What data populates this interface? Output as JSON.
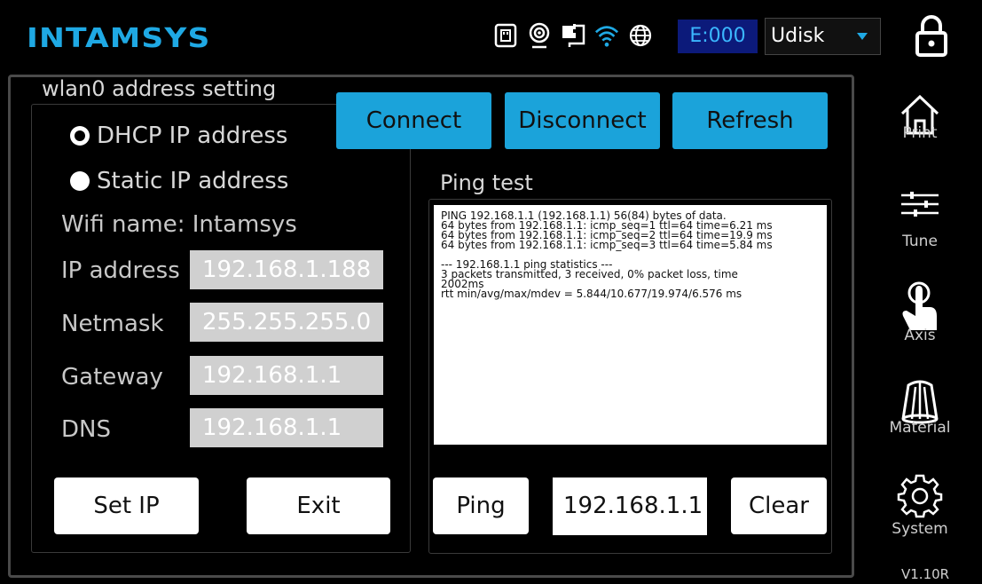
{
  "header": {
    "logo": "INTAMSYS",
    "status_icons": [
      "usb-drive-icon",
      "camera-icon",
      "power-plug-icon",
      "wifi-icon",
      "globe-icon"
    ],
    "error_code": "E:000",
    "storage_select": {
      "value": "Udisk"
    },
    "lock_icon": "lock-icon"
  },
  "panel": {
    "title": "wlan0 address setting",
    "top_buttons": {
      "connect": "Connect",
      "disconnect": "Disconnect",
      "refresh": "Refresh"
    },
    "mode": {
      "dhcp_label": "DHCP IP address",
      "static_label": "Static IP address",
      "selected": "dhcp"
    },
    "wifi_name": "Wifi name: Intamsys",
    "fields": {
      "ip_label": "IP address",
      "ip_value": "192.168.1.188",
      "netmask_label": "Netmask",
      "netmask_value": "255.255.255.0",
      "gateway_label": "Gateway",
      "gateway_value": "192.168.1.1",
      "dns_label": "DNS",
      "dns_value": "192.168.1.1"
    },
    "set_ip_button": "Set IP",
    "exit_button": "Exit",
    "ping": {
      "title": "Ping test",
      "output": [
        "PING 192.168.1.1 (192.168.1.1) 56(84) bytes of data.",
        "64 bytes from 192.168.1.1: icmp_seq=1 ttl=64 time=6.21 ms",
        "64 bytes from 192.168.1.1: icmp_seq=2 ttl=64 time=19.9 ms",
        "64 bytes from 192.168.1.1: icmp_seq=3 ttl=64 time=5.84 ms",
        "",
        "--- 192.168.1.1 ping statistics ---",
        "3 packets transmitted, 3 received, 0% packet loss, time",
        "2002ms",
        "rtt min/avg/max/mdev = 5.844/10.677/19.974/6.576 ms"
      ],
      "ping_button": "Ping",
      "target_value": "192.168.1.1",
      "clear_button": "Clear"
    }
  },
  "nav": {
    "print": "Print",
    "tune": "Tune",
    "axis": "Axis",
    "material": "Material",
    "system": "System"
  },
  "version": "V1.10R",
  "colors": {
    "accent": "#1ba3da",
    "logo": "#1fa9e4",
    "error_bg": "#0c1a7a"
  }
}
